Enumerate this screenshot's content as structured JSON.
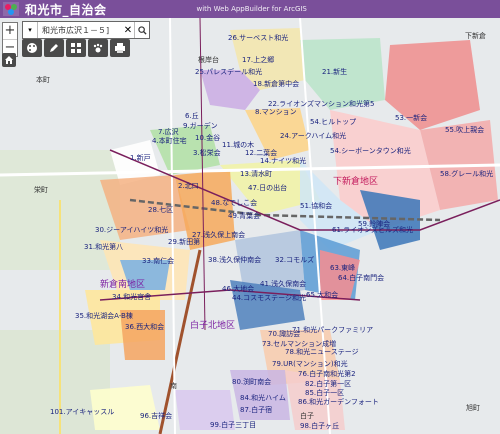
{
  "app": {
    "title": "和光市_自治会",
    "subtitle": "with Web AppBuilder for ArcGIS"
  },
  "search": {
    "value": "和光市広沢１－５]"
  },
  "zoom": {
    "in": "+",
    "out": "−"
  },
  "toolbar": [
    "palette-icon",
    "edit-icon",
    "grid-icon",
    "paw-icon",
    "print-icon"
  ],
  "district_labels": [
    "下新倉地区",
    "新倉南地区",
    "白子北地区"
  ],
  "place_labels": [
    "下新倉",
    "本町",
    "栄町",
    "南",
    "旭町",
    "白子",
    "根岸台"
  ],
  "associations": [
    "26.サーベスト和光",
    "17.上之郷",
    "25.パレスデール和光",
    "21.新生",
    "18.新倉第中会",
    "9.ガーデン",
    "22.ライオンズマンション和光第5",
    "8.マンション",
    "6.丘",
    "24.アークハイム和光",
    "53.一新会",
    "7.広沢",
    "4.本町住宅",
    "10.金谷",
    "11.城の木",
    "3.松栄会",
    "12.二葉会",
    "54.ヒルトップ",
    "54.シーボーンタウン和光",
    "55.吹上親会",
    "1.新戸",
    "2.北口",
    "13.清水町",
    "14.ナイツ和光",
    "58.グレール和光",
    "28.七区",
    "47.日の出台",
    "48.なでしこ会",
    "49.青葉会",
    "51.協和会",
    "59.鈴陣会",
    "30.ジーアイハイツ和光",
    "27.浅久保上南会",
    "29.新田第",
    "61.ライオンズヒルズ和光",
    "31.和光第八",
    "33.南仁会",
    "38.浅久保仲南会",
    "32.コモルズ",
    "63.東峰",
    "64.白子南門会",
    "34.和光官舎",
    "41.浅久保南会",
    "46.大地会",
    "35.和光湖会A-B棟",
    "44.コスモステージ和光",
    "65.大和会",
    "36.西大和会",
    "70.諏訪会",
    "71.和光パークファミリア",
    "73.セルマンション成増",
    "78.和光ニューステージ",
    "79.UR(マンション)和光",
    "76.白子南和光第2",
    "80.渕町南会",
    "82.白子第一区",
    "84.和光ハイム",
    "85.白子一区",
    "86.和光ガーデンフォート",
    "87.白子宿",
    "101.アイキャッスル",
    "96.吉祥会",
    "99.白子三丁目",
    "98.白子ヶ丘"
  ]
}
